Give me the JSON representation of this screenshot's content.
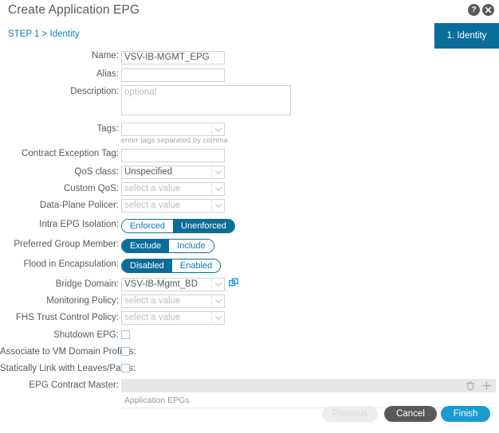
{
  "header": {
    "title": "Create Application EPG",
    "help_icon": "help-icon",
    "close_icon": "close-icon"
  },
  "step": {
    "breadcrumb": "STEP 1 > Identity",
    "tab_label": "1. Identity"
  },
  "form": {
    "name": {
      "label": "Name:",
      "value": "VSV-IB-MGMT_EPG",
      "placeholder": ""
    },
    "alias": {
      "label": "Alias:",
      "value": "",
      "placeholder": ""
    },
    "description": {
      "label": "Description:",
      "value": "",
      "placeholder": "optional"
    },
    "tags": {
      "label": "Tags:",
      "value": "",
      "placeholder": "",
      "hint": "enter tags separated by comma"
    },
    "contract_exception_tag": {
      "label": "Contract Exception Tag:",
      "value": "",
      "placeholder": ""
    },
    "qos_class": {
      "label": "QoS class:",
      "value": "Unspecified",
      "is_placeholder": false
    },
    "custom_qos": {
      "label": "Custom QoS:",
      "value": "select a value",
      "is_placeholder": true
    },
    "data_plane_policer": {
      "label": "Data-Plane Policer:",
      "value": "select a value",
      "is_placeholder": true
    },
    "intra_epg_isolation": {
      "label": "Intra EPG Isolation:",
      "options": [
        "Enforced",
        "Unenforced"
      ],
      "selected": "Unenforced"
    },
    "preferred_group_member": {
      "label": "Preferred Group Member:",
      "options": [
        "Exclude",
        "Include"
      ],
      "selected": "Exclude"
    },
    "flood_in_encapsulation": {
      "label": "Flood in Encapsulation:",
      "options": [
        "Disabled",
        "Enabled"
      ],
      "selected": "Disabled"
    },
    "bridge_domain": {
      "label": "Bridge Domain:",
      "value": "VSV-IB-Mgmt_BD",
      "is_placeholder": false,
      "link_icon": "open-external-icon"
    },
    "monitoring_policy": {
      "label": "Monitoring Policy:",
      "value": "select a value",
      "is_placeholder": true
    },
    "fhs_trust_control_policy": {
      "label": "FHS Trust Control Policy:",
      "value": "select a value",
      "is_placeholder": true
    },
    "shutdown_epg": {
      "label": "Shutdown EPG:",
      "checked": false
    },
    "associate_vm_domain_profiles": {
      "label": "Associate to VM Domain Profiles:",
      "checked": false
    },
    "statically_link_leaves_paths": {
      "label": "Statically Link with Leaves/Paths:",
      "checked": false
    },
    "epg_contract_master": {
      "label": "EPG Contract Master:",
      "column_header": "Application EPGs",
      "delete_icon": "trash-icon",
      "add_icon": "plus-icon",
      "rows": []
    }
  },
  "footer": {
    "previous_label": "Previous",
    "cancel_label": "Cancel",
    "finish_label": "Finish"
  },
  "colors": {
    "accent_blue": "#0b6d99",
    "link_blue": "#0d7cb5",
    "finish_blue": "#1b9bd0",
    "cancel_gray": "#58595b",
    "border_gray": "#d0d2d3",
    "toolbar_gray": "#e6e7e8"
  }
}
